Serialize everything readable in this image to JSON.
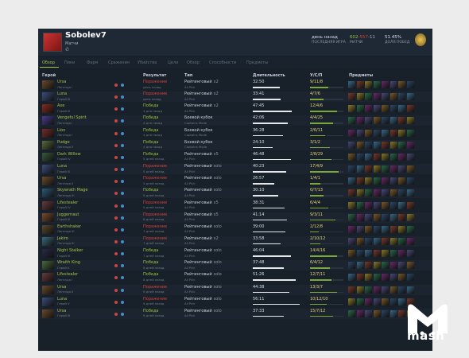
{
  "player": {
    "name": "Sobolev7",
    "subtitle": "Матчи",
    "icon": "phone-icon"
  },
  "stats": {
    "last_game": "день назад",
    "last_game_label": "ПОСЛЕДНЯЯ ИГРА",
    "wins": "602",
    "sep1": "-",
    "losses": "557",
    "sep2": "-",
    "abandons": "11",
    "matches_label": "МАТЧИ",
    "winrate": "51.45%",
    "winrate_label": "ДОЛЯ ПОБЕД"
  },
  "tabs": [
    "Обзор",
    "Пики",
    "Фарм",
    "Сражения",
    "Убийства",
    "Цели",
    "Обзор",
    "Способности",
    "Предметы"
  ],
  "columns": {
    "hero": "Герой",
    "result": "Результат",
    "type": "Тип",
    "duration": "Длительность",
    "kda": "У/С/П",
    "items": "Предметы"
  },
  "colors": {
    "win": "#93c13e",
    "loss": "#d2413a",
    "accent": "#a6c14b",
    "bg": "#182029"
  },
  "matches": [
    {
      "hero": "Ursa",
      "rank": "Легенда I",
      "result": "Поражение",
      "when": "день назад",
      "win": false,
      "type": "Рейтинговый",
      "mode": "All Pick",
      "party": "x2",
      "dur": "32:50",
      "kda": "9/11/8",
      "k": 0.55,
      "hc": "#6b4a2a"
    },
    {
      "hero": "Luna",
      "rank": "Герой III",
      "result": "Поражение",
      "when": "день назад",
      "win": false,
      "type": "Рейтинговый",
      "mode": "All Pick",
      "party": "x2",
      "dur": "33:41",
      "kda": "4/7/6",
      "k": 0.4,
      "hc": "#3b4f7a"
    },
    {
      "hero": "Axe",
      "rank": "Герой III",
      "result": "Победа",
      "when": "4 дня назад",
      "win": true,
      "type": "Рейтинговый",
      "mode": "All Pick",
      "party": "x2",
      "dur": "47:45",
      "kda": "12/4/6",
      "k": 0.8,
      "hc": "#8a2a1e"
    },
    {
      "hero": "Vengeful Spirit",
      "rank": "Легенда I",
      "result": "Победа",
      "when": "4 дня назад",
      "win": true,
      "type": "Боевой кубок",
      "mode": "Captains Mode",
      "party": "",
      "dur": "42:06",
      "kda": "4/4/25",
      "k": 0.7,
      "hc": "#4a3a8a"
    },
    {
      "hero": "Lion",
      "rank": "Легенда I",
      "result": "Победа",
      "when": "4 дня назад",
      "win": true,
      "type": "Боевой кубок",
      "mode": "Captains Mode",
      "party": "",
      "dur": "36:28",
      "kda": "2/6/11",
      "k": 0.45,
      "hc": "#7a2a2a"
    },
    {
      "hero": "Pudge",
      "rank": "Легенда II",
      "result": "Победа",
      "when": "4 дня назад",
      "win": true,
      "type": "Боевой кубок",
      "mode": "Captains Mode",
      "party": "",
      "dur": "24:10",
      "kda": "3/1/2",
      "k": 0.6,
      "hc": "#5a6a3a"
    },
    {
      "hero": "Dark Willow",
      "rank": "Герой IV",
      "result": "Победа",
      "when": "5 дней назад",
      "win": true,
      "type": "Рейтинговый",
      "mode": "All Pick",
      "party": "x5",
      "dur": "46:48",
      "kda": "2/8/29",
      "k": 0.65,
      "hc": "#3a5a3a"
    },
    {
      "hero": "Luna",
      "rank": "Герой III",
      "result": "Поражение",
      "when": "5 дней назад",
      "win": false,
      "type": "Рейтинговый",
      "mode": "All Pick",
      "party": "solo",
      "dur": "40:23",
      "kda": "17/4/9",
      "k": 0.85,
      "hc": "#3b4f7a"
    },
    {
      "hero": "Ursa",
      "rank": "Легенда II",
      "result": "Поражение",
      "when": "5 дней назад",
      "win": false,
      "type": "Рейтинговый",
      "mode": "All Pick",
      "party": "solo",
      "dur": "26:57",
      "kda": "1/4/1",
      "k": 0.3,
      "hc": "#6b4a2a"
    },
    {
      "hero": "Skywrath Mage",
      "rank": "Легенда III",
      "result": "Победа",
      "when": "5 дней назад",
      "win": true,
      "type": "Рейтинговый",
      "mode": "All Pick",
      "party": "solo",
      "dur": "30:10",
      "kda": "0/7/13",
      "k": 0.4,
      "hc": "#2a5a7a"
    },
    {
      "hero": "Lifestealer",
      "rank": "Герой IV",
      "result": "Поражение",
      "when": "5 дней назад",
      "win": false,
      "type": "Рейтинговый",
      "mode": "All Pick",
      "party": "x5",
      "dur": "38:31",
      "kda": "6/4/4",
      "k": 0.55,
      "hc": "#6a3a3a"
    },
    {
      "hero": "Juggernaut",
      "rank": "Герой III",
      "result": "Поражение",
      "when": "6 дней назад",
      "win": false,
      "type": "Рейтинговый",
      "mode": "All Pick",
      "party": "x5",
      "dur": "41:14",
      "kda": "9/3/11",
      "k": 0.75,
      "hc": "#7a4a2a"
    },
    {
      "hero": "Earthshaker",
      "rank": "Легенда III",
      "result": "Поражение",
      "when": "7 дней назад",
      "win": false,
      "type": "Рейтинговый",
      "mode": "All Pick",
      "party": "solo",
      "dur": "39:00",
      "kda": "2/12/8",
      "k": 0.25,
      "hc": "#5a4a2a"
    },
    {
      "hero": "Jakiro",
      "rank": "Легенда III",
      "result": "Поражение",
      "when": "7 дней назад",
      "win": false,
      "type": "Рейтинговый",
      "mode": "All Pick",
      "party": "x2",
      "dur": "33:58",
      "kda": "2/10/12",
      "k": 0.3,
      "hc": "#3a6a7a"
    },
    {
      "hero": "Night Stalker",
      "rank": "Герой III",
      "result": "Победа",
      "when": "7 дней назад",
      "win": true,
      "type": "Рейтинговый",
      "mode": "All Pick",
      "party": "solo",
      "dur": "46:04",
      "kda": "14/4/16",
      "k": 0.8,
      "hc": "#2a2a4a"
    },
    {
      "hero": "Wraith King",
      "rank": "Герой II",
      "result": "Победа",
      "when": "8 дней назад",
      "win": true,
      "type": "Рейтинговый",
      "mode": "All Pick",
      "party": "solo",
      "dur": "37:48",
      "kda": "6/4/12",
      "k": 0.6,
      "hc": "#4a6a3a"
    },
    {
      "hero": "Lifestealer",
      "rank": "Легенда I",
      "result": "Победа",
      "when": "8 дней назад",
      "win": true,
      "type": "Рейтинговый",
      "mode": "All Pick",
      "party": "solo",
      "dur": "51:26",
      "kda": "12/7/11",
      "k": 0.65,
      "hc": "#6a3a3a"
    },
    {
      "hero": "Ursa",
      "rank": "Легенда II",
      "result": "Поражение",
      "when": "9 дней назад",
      "win": false,
      "type": "Рейтинговый",
      "mode": "All Pick",
      "party": "solo",
      "dur": "44:38",
      "kda": "13/3/7",
      "k": 0.8,
      "hc": "#6b4a2a"
    },
    {
      "hero": "Luna",
      "rank": "Герой V",
      "result": "Поражение",
      "when": "9 дней назад",
      "win": false,
      "type": "Рейтинговый",
      "mode": "All Pick",
      "party": "solo",
      "dur": "56:11",
      "kda": "10/12/10",
      "k": 0.5,
      "hc": "#3b4f7a"
    },
    {
      "hero": "Ursa",
      "rank": "Герой III",
      "result": "Победа",
      "when": "9 дней назад",
      "win": true,
      "type": "Рейтинговый",
      "mode": "All Pick",
      "party": "solo",
      "dur": "37:33",
      "kda": "15/7/12",
      "k": 0.7,
      "hc": "#6b4a2a"
    }
  ],
  "watermark": "mash"
}
